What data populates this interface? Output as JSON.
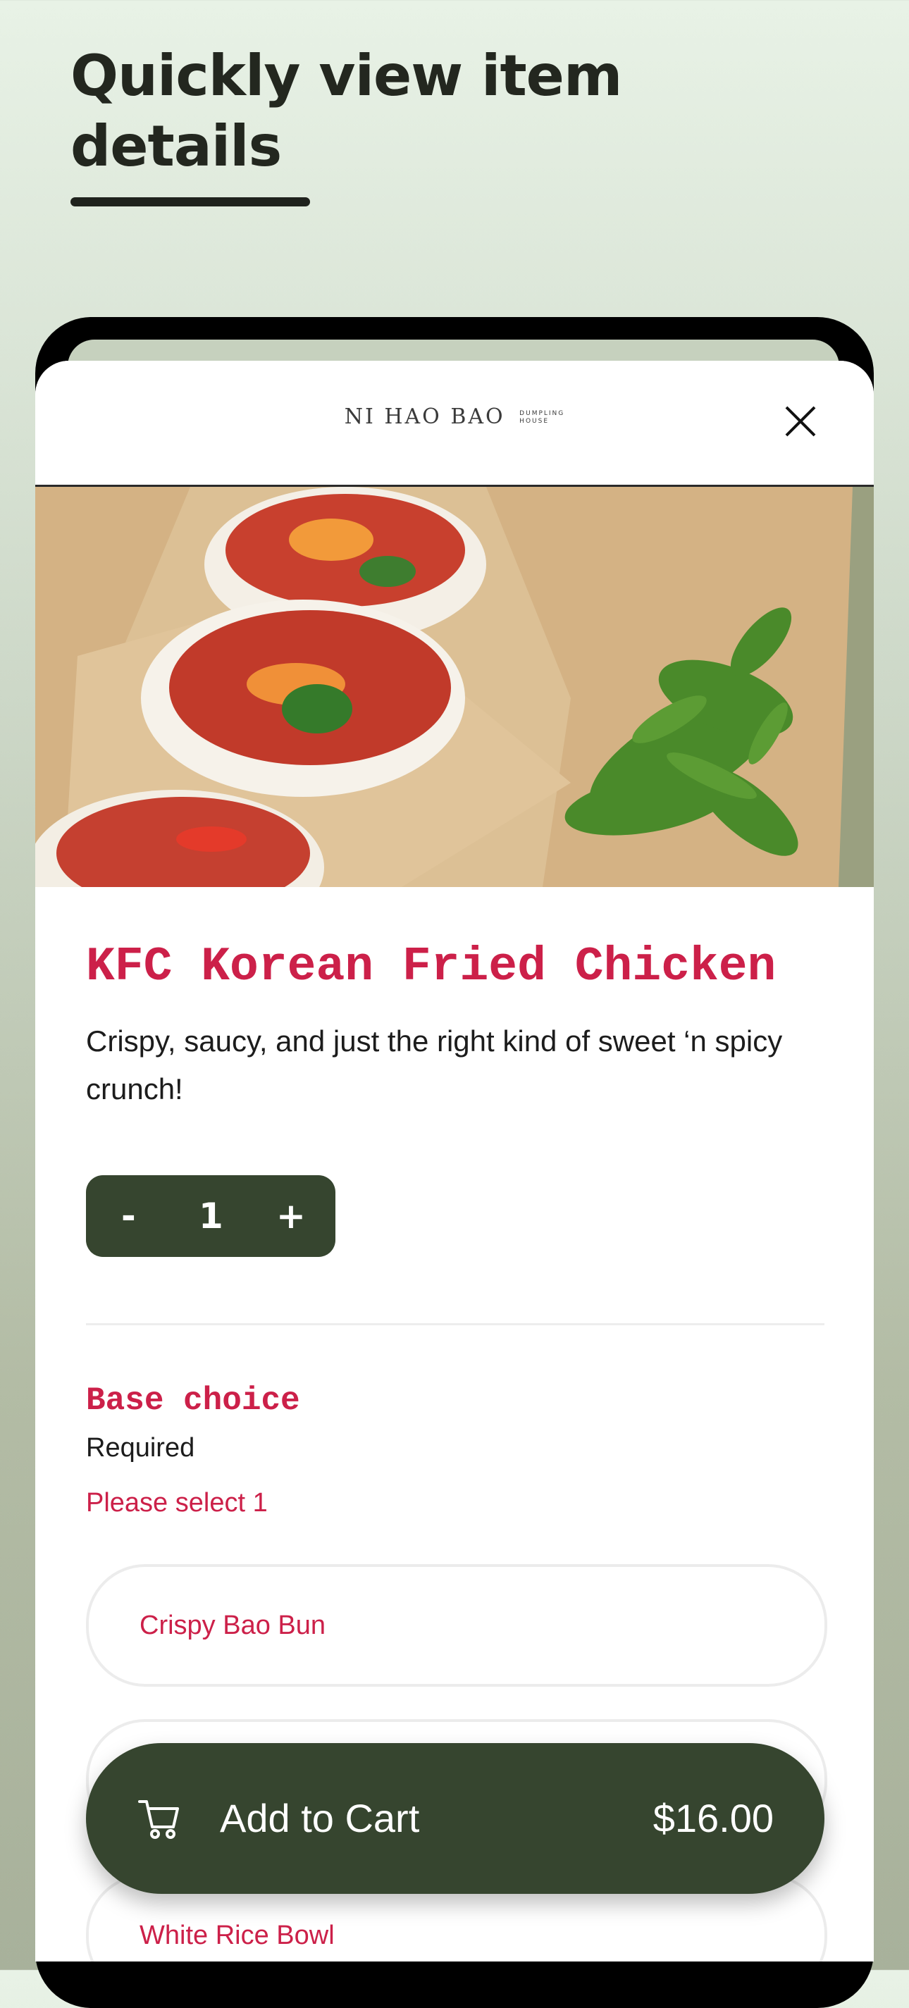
{
  "headline": "Quickly view item details",
  "header": {
    "logo_text": "NI HAO BAO",
    "logo_sub_1": "DUMPLING",
    "logo_sub_2": "HOUSE",
    "close_icon": "close-icon"
  },
  "item": {
    "image_subject": "bao buns with fried chicken and edamame",
    "title": "KFC Korean Fried Chicken",
    "description": "Crispy, saucy, and just the right kind of sweet ‘n spicy crunch!",
    "quantity": {
      "minus_label": "-",
      "value": "1",
      "plus_label": "+"
    }
  },
  "base_choice": {
    "title": "Base choice",
    "requirement": "Required",
    "hint": "Please select 1",
    "options": [
      "Crispy Bao Bun",
      "",
      "White Rice Bowl"
    ]
  },
  "cart": {
    "icon": "cart-icon",
    "label": "Add to Cart",
    "price": "$16.00"
  },
  "colors": {
    "accent": "#cc2049",
    "primary_dark": "#36452f",
    "background": "#e8f2e6"
  }
}
